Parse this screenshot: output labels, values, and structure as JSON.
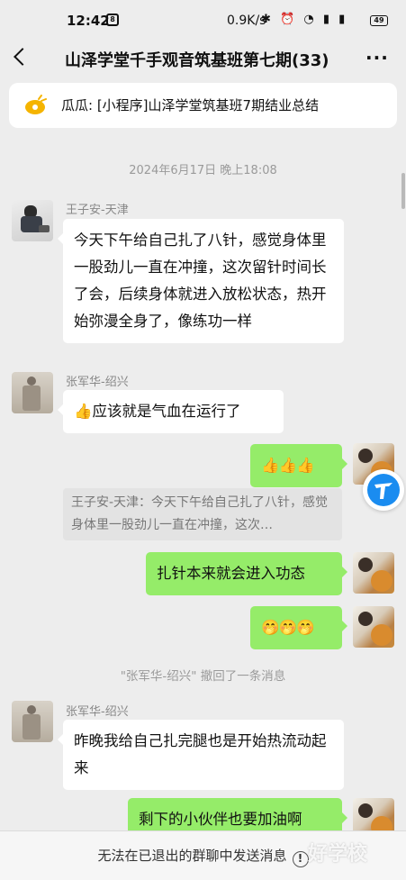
{
  "status_bar": {
    "time": "12:42",
    "notif_glyph": "8",
    "network_speed": "0.9K/s",
    "icons": "✱ ⏰ ◔ ▮ ▮",
    "battery": "49"
  },
  "header": {
    "title": "山泽学堂千手观音筑基班第七期(33)",
    "more_glyph": "···"
  },
  "pinned": {
    "text": "瓜瓜: [小程序]山泽学堂筑基班7期结业总结",
    "icon": "megaphone-icon"
  },
  "chat": {
    "timestamp": "2024年6月17日 晚上18:08",
    "messages": [
      {
        "sender": "王子安-天津",
        "text": "今天下午给自己扎了八针，感觉身体里一股劲儿一直在冲撞，这次留针时间长了会，后续身体就进入放松状态，热开始弥漫全身了，像练功一样"
      },
      {
        "sender": "张军华-绍兴",
        "text": "👍应该就是气血在运行了"
      },
      {
        "text": "👍👍👍"
      },
      {
        "quote": "王子安-天津：今天下午给自己扎了八针，感觉身体里一股劲儿一直在冲撞，这次…",
        "text": "扎针本来就会进入功态"
      },
      {
        "text": "🤭🤭🤭"
      },
      {
        "system": "\"张军华-绍兴\" 撤回了一条消息"
      },
      {
        "sender": "张军华-绍兴",
        "text": "昨晚我给自己扎完腿也是开始热流动起来"
      },
      {
        "text": "剩下的小伙伴也要加油啊"
      }
    ]
  },
  "bottom_bar": {
    "text": "无法在已退出的群聊中发送消息",
    "info_glyph": "!"
  },
  "watermark": "好学校",
  "colors": {
    "background": "#ededed",
    "bubble_self": "#95ec69",
    "bubble_other": "#ffffff",
    "float_button": "#1a8cf0"
  }
}
